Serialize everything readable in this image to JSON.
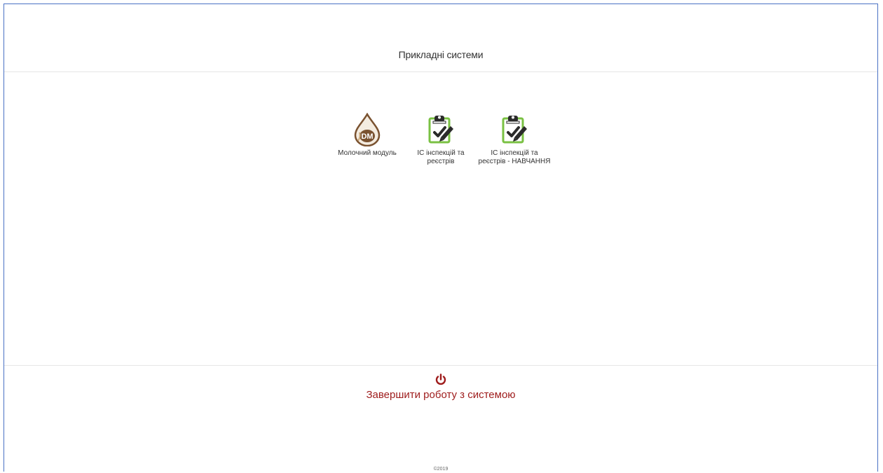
{
  "header": {
    "title": "Прикладні системи"
  },
  "apps": [
    {
      "label": "Молочний модуль",
      "icon": "dm-drop-icon"
    },
    {
      "label": "ІС інспекцій та реєстрів",
      "icon": "clipboard-check-icon"
    },
    {
      "label": "ІС інспекцій та реєстрів - НАВЧАННЯ",
      "icon": "clipboard-check-icon"
    }
  ],
  "logout": {
    "label": "Завершити роботу з системою",
    "icon": "power-icon",
    "color": "#9e1b1b"
  },
  "footer": {
    "copyright": "©2019"
  },
  "colors": {
    "accent_green": "#7ac143",
    "brand_brown": "#7a5230",
    "frame_border": "#4a72c4"
  }
}
